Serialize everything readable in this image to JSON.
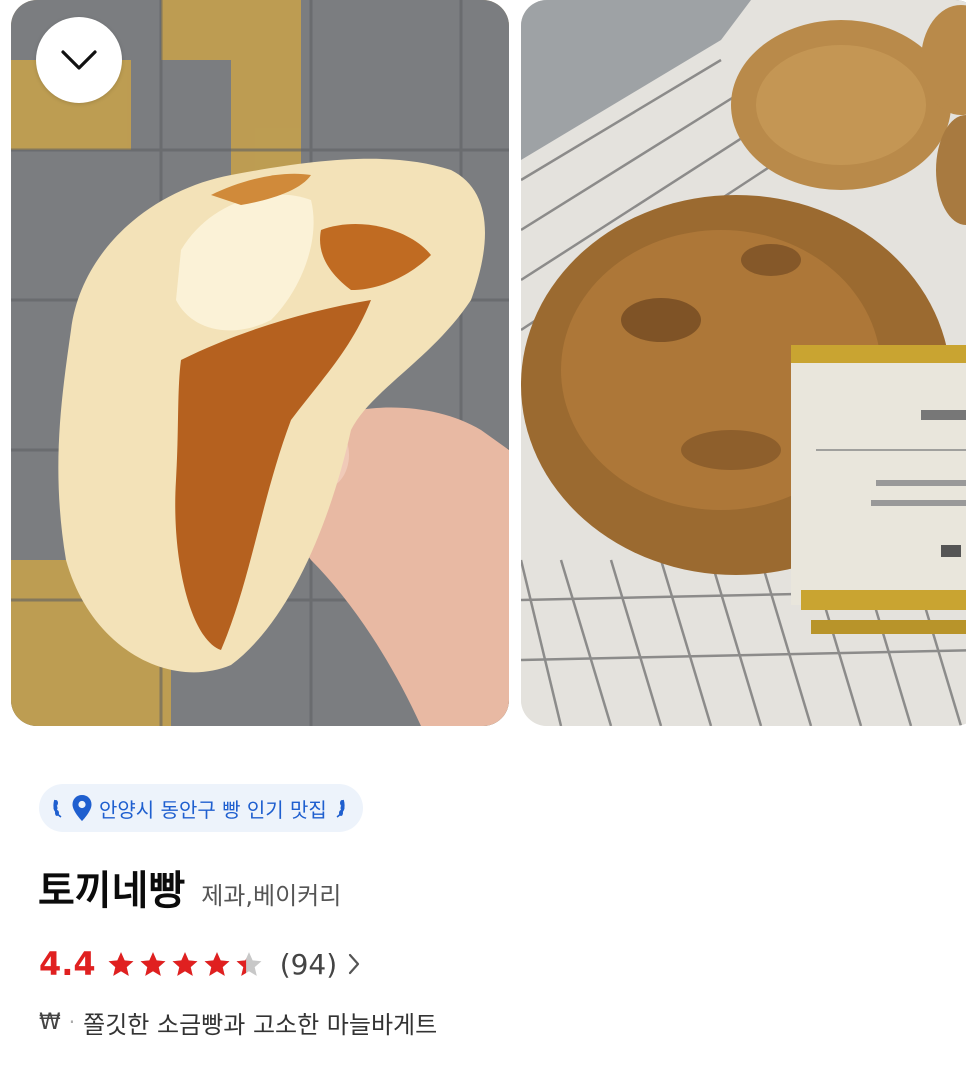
{
  "photos": [
    {
      "name": "photo-bread-in-hand",
      "alt": ""
    },
    {
      "name": "photo-bread-on-rack",
      "alt": ""
    }
  ],
  "badge": {
    "text": "안양시 동안구 빵 인기 맛집",
    "icon": "location-pin-icon",
    "laurel_icon": "laurel-icon",
    "color": "#1f5fcf",
    "background": "#edf3fb"
  },
  "place": {
    "name": "토끼네빵",
    "category": "제과,베이커리"
  },
  "rating": {
    "score": "4.4",
    "stars": 4.4,
    "max_stars": 5,
    "review_count": "(94)",
    "star_color": "#e02020",
    "empty_star_color": "#c8c8c8"
  },
  "summary": {
    "price_symbol": "₩",
    "separator": "·",
    "description": "쫄깃한 소금빵과 고소한 마늘바게트"
  },
  "icons": {
    "collapse": "chevron-down-icon",
    "more": "chevron-right-icon"
  }
}
